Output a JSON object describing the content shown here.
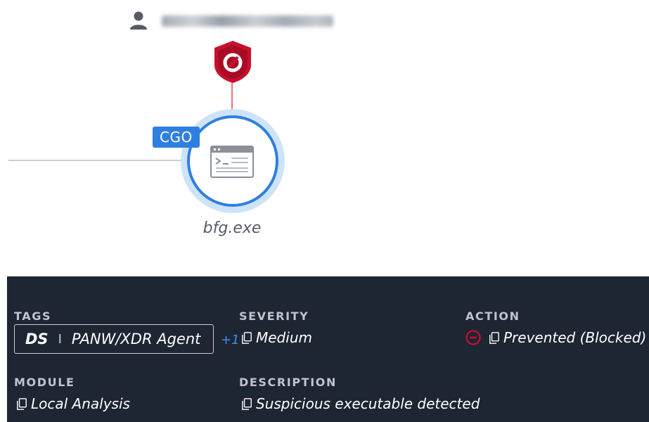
{
  "graph": {
    "username": "",
    "node_badge": "CGO",
    "node_label": "bfg.exe",
    "icons": [
      "user-icon",
      "shield-alert-icon",
      "application-window-icon"
    ]
  },
  "details": {
    "tags": {
      "label": "TAGS",
      "tag_prefix": "DS",
      "tag_separator": "I",
      "tag_value": "PANW/XDR Agent",
      "more": "+1"
    },
    "severity": {
      "label": "SEVERITY",
      "value": "Medium"
    },
    "action": {
      "label": "ACTION",
      "value": "Prevented (Blocked)"
    },
    "module": {
      "label": "MODULE",
      "value": "Local Analysis"
    },
    "description": {
      "label": "DESCRIPTION",
      "value": "Suspicious executable detected"
    }
  },
  "colors": {
    "panel_bg": "#1e2533",
    "accent_blue": "#2f7fe0",
    "alert_red": "#c8102e",
    "connector_red": "#e8747a"
  }
}
